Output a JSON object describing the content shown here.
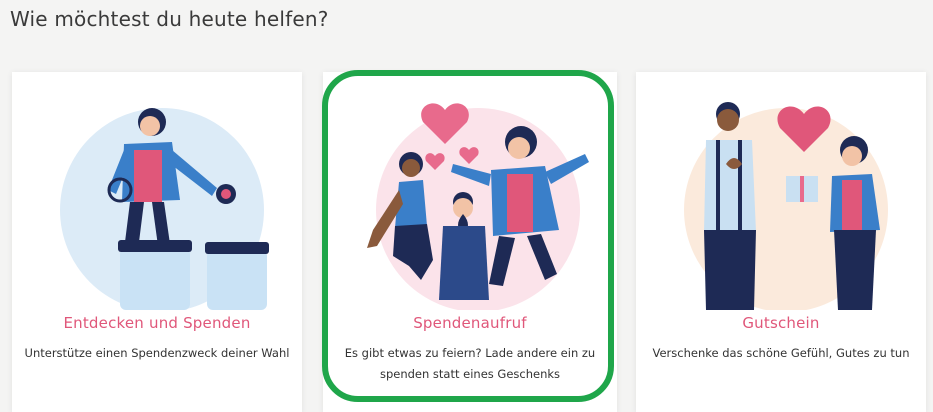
{
  "heading": "Wie möchtest du heute helfen?",
  "colors": {
    "accent_pink": "#e0577a",
    "highlight_green": "#1fa64a",
    "jacket_blue": "#3a7fc9",
    "navy": "#1e2a55"
  },
  "cards": [
    {
      "title": "Entdecken und Spenden",
      "description": "Unterstütze einen Spendenzweck deiner Wahl",
      "illustration": "woman-donating-jars"
    },
    {
      "title": "Spendenaufruf",
      "description": "Es gibt etwas zu feiern? Lade andere ein zu spenden statt eines Geschenks",
      "illustration": "people-celebrating-hearts",
      "selected": true
    },
    {
      "title": "Gutschein",
      "description": "Verschenke das schöne Gefühl, Gutes zu tun",
      "illustration": "gift-with-heart"
    }
  ]
}
